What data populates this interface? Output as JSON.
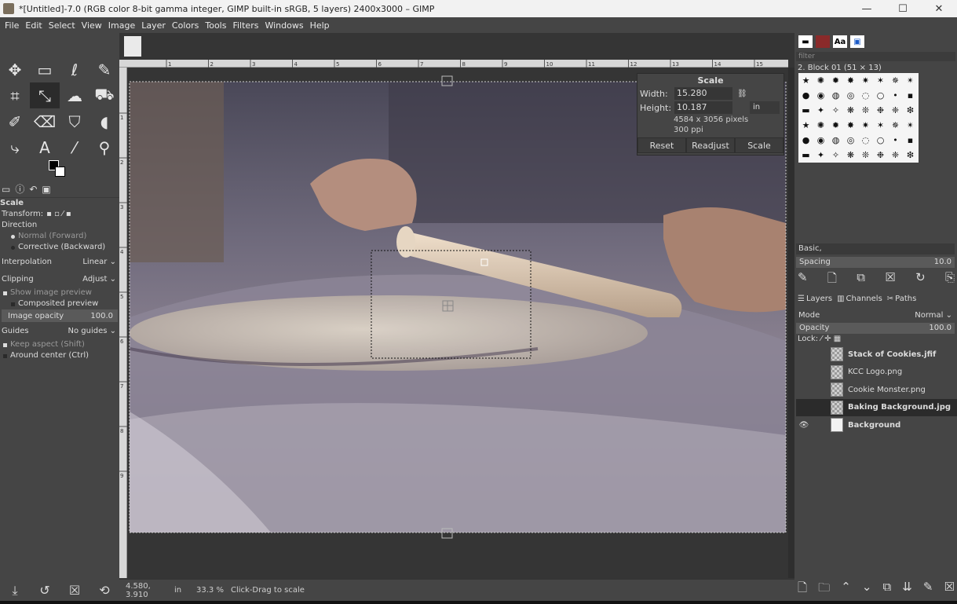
{
  "window": {
    "title": "*[Untitled]-7.0 (RGB color 8-bit gamma integer, GIMP built-in sRGB, 5 layers) 2400x3000 – GIMP",
    "minimize": "—",
    "maximize": "☐",
    "close": "✕"
  },
  "menu": [
    "File",
    "Edit",
    "Select",
    "View",
    "Image",
    "Layer",
    "Colors",
    "Tools",
    "Filters",
    "Windows",
    "Help"
  ],
  "tools": [
    {
      "name": "move-tool-icon",
      "glyph": "✥"
    },
    {
      "name": "rect-select-tool-icon",
      "glyph": "▭"
    },
    {
      "name": "free-select-tool-icon",
      "glyph": "ℓ"
    },
    {
      "name": "fuzzy-select-tool-icon",
      "glyph": "✎"
    },
    {
      "name": "crop-tool-icon",
      "glyph": "⌗"
    },
    {
      "name": "scale-tool-icon",
      "glyph": "⤡"
    },
    {
      "name": "warp-tool-icon",
      "glyph": "☁"
    },
    {
      "name": "bucket-fill-tool-icon",
      "glyph": "⛟"
    },
    {
      "name": "paintbrush-tool-icon",
      "glyph": "✐"
    },
    {
      "name": "eraser-tool-icon",
      "glyph": "⌫"
    },
    {
      "name": "clone-tool-icon",
      "glyph": "⛉"
    },
    {
      "name": "smudge-tool-icon",
      "glyph": "◖"
    },
    {
      "name": "paths-tool-icon",
      "glyph": "⤷"
    },
    {
      "name": "text-tool-icon",
      "glyph": "A"
    },
    {
      "name": "color-picker-tool-icon",
      "glyph": "⁄"
    },
    {
      "name": "zoom-tool-icon",
      "glyph": "⚲"
    }
  ],
  "tool_options": {
    "title": "Scale",
    "transform_label": "Transform:",
    "direction_label": "Direction",
    "direction_options": [
      "Normal (Forward)",
      "Corrective (Backward)"
    ],
    "interpolation_label": "Interpolation",
    "interpolation_value": "Linear",
    "clipping_label": "Clipping",
    "clipping_value": "Adjust",
    "show_preview": "Show image preview",
    "composited_preview": "Composited preview",
    "image_opacity_label": "Image opacity",
    "image_opacity_value": "100.0",
    "guides_label": "Guides",
    "guides_value": "No guides",
    "keep_aspect": "Keep aspect (Shift)",
    "around_center": "Around center (Ctrl)"
  },
  "scale_dialog": {
    "title": "Scale",
    "width_label": "Width:",
    "width_value": "15.280",
    "height_label": "Height:",
    "height_value": "10.187",
    "unit": "in",
    "pixels": "4584 x 3056 pixels",
    "ppi": "300 ppi",
    "reset": "Reset",
    "readjust": "Readjust",
    "scale": "Scale"
  },
  "status": {
    "coords": "4.580, 3.910",
    "unit": "in",
    "zoom": "33.3 %",
    "message": "Click-Drag to scale"
  },
  "brushes": {
    "filter_placeholder": "filter",
    "current": "2. Block 01 (51 × 13)",
    "preset": "Basic,",
    "spacing_label": "Spacing",
    "spacing_value": "10.0"
  },
  "layers_panel": {
    "tabs": [
      "Layers",
      "Channels",
      "Paths"
    ],
    "mode_label": "Mode",
    "mode_value": "Normal",
    "opacity_label": "Opacity",
    "opacity_value": "100.0",
    "lock_label": "Lock:",
    "layers": [
      {
        "name": "Stack of Cookies.jfif",
        "bold": true,
        "visible": false,
        "selected": false
      },
      {
        "name": "KCC Logo.png",
        "bold": false,
        "visible": false,
        "selected": false
      },
      {
        "name": "Cookie Monster.png",
        "bold": false,
        "visible": false,
        "selected": false
      },
      {
        "name": "Baking Background.jpg",
        "bold": true,
        "visible": false,
        "selected": true
      },
      {
        "name": "Background",
        "bold": true,
        "visible": true,
        "selected": false
      }
    ]
  },
  "ruler_labels": [
    "1",
    "2",
    "3",
    "4",
    "5",
    "6",
    "7",
    "8",
    "9",
    "10",
    "11",
    "12",
    "13",
    "14",
    "15",
    "16"
  ],
  "vruler_labels": [
    "1",
    "2",
    "3",
    "4",
    "5",
    "6",
    "7",
    "8",
    "9"
  ]
}
